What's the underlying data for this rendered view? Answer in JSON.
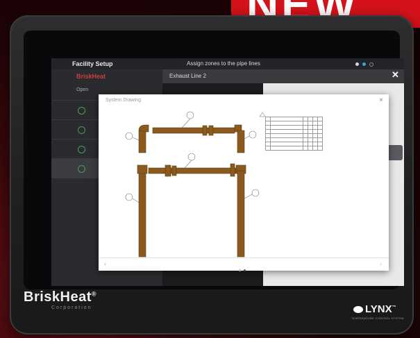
{
  "banner": {
    "text": "NEW"
  },
  "device": {
    "brand": "BriskHeat",
    "brand_mark": "®",
    "brand_sub": "Corporation",
    "product_logo": "LYNX",
    "product_mark": "™",
    "product_sub": "TEMPERATURE CONTROL SYSTEM"
  },
  "app": {
    "title": "Facility Setup",
    "instruction": "Assign zones to the pipe lines",
    "sidebar": {
      "logo": "BriskHeat",
      "subtitle": "Open"
    },
    "breadcrumb": "Exhaust Line 2"
  },
  "dialog": {
    "title": "System Drawing",
    "close": "×",
    "prev": "‹",
    "next": "›"
  },
  "colors": {
    "accent": "#d5121b",
    "pipe": "#8b5a1e",
    "check": "#4a9a5a"
  },
  "icons": [
    "check-icon",
    "close-icon",
    "chevron-left-icon",
    "chevron-right-icon",
    "zone-marker-icon"
  ]
}
